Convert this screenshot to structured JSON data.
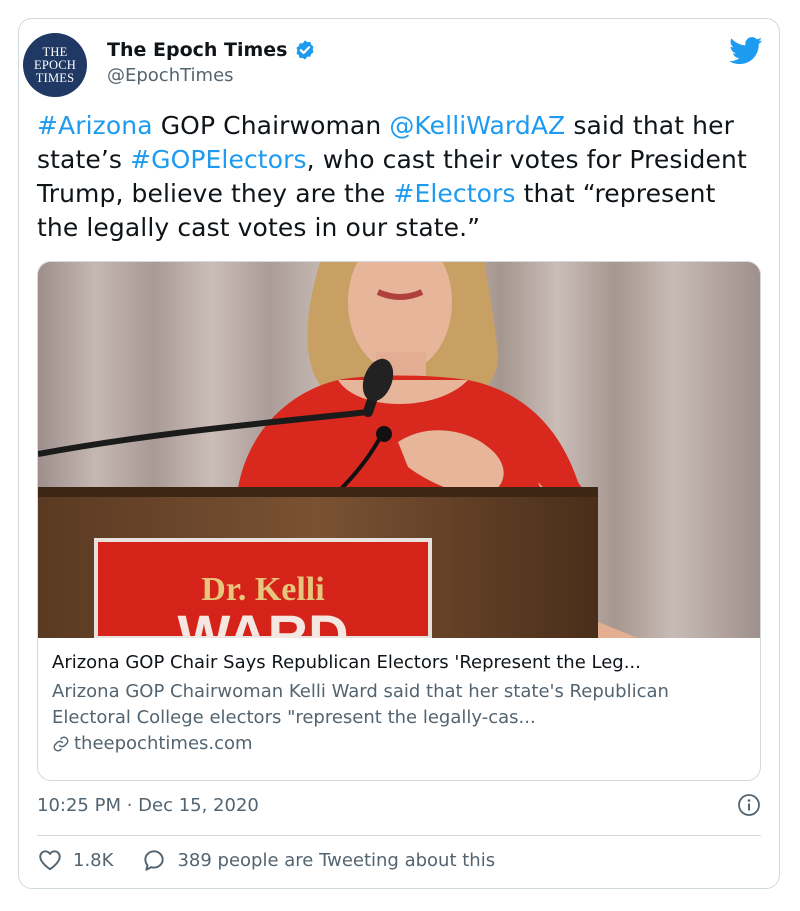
{
  "account": {
    "name": "The Epoch Times",
    "handle": "@EpochTimes",
    "avatar_lines": [
      "THE",
      "EPOCH",
      "TIMES"
    ]
  },
  "tweet": {
    "segments": [
      {
        "text": "#Arizona",
        "link": true
      },
      {
        "text": " GOP Chairwoman ",
        "link": false
      },
      {
        "text": "@KelliWardAZ",
        "link": true
      },
      {
        "text": " said that her state’s ",
        "link": false
      },
      {
        "text": "#GOPElectors",
        "link": true
      },
      {
        "text": ", who cast their votes for President Trump, believe they are the ",
        "link": false
      },
      {
        "text": "#Electors",
        "link": true
      },
      {
        "text": " that “represent the legally cast votes in our state.”",
        "link": false
      }
    ]
  },
  "card": {
    "sign_line1": "Dr. Kelli",
    "sign_line2": "WARD",
    "title": "Arizona GOP Chair Says Republican Electors 'Represent the Leg...",
    "description": "Arizona GOP Chairwoman Kelli Ward said that her state's Republican Electoral College electors \"represent the legally-cas...",
    "domain": "theepochtimes.com"
  },
  "timestamp": "10:25 PM · Dec 15, 2020",
  "actions": {
    "likes": "1.8K",
    "replies_label": "389 people are Tweeting about this"
  },
  "colors": {
    "link": "#1d9bf0",
    "muted": "#536471",
    "border": "#cfd9de",
    "verified": "#1d9bf0",
    "avatar_bg": "#1f3864",
    "dress": "#d9281e",
    "sign": "#d6231a"
  },
  "icons": {
    "verified": "verified-badge-icon",
    "brand": "twitter-bird-icon",
    "info": "info-icon",
    "like": "heart-icon",
    "reply": "speech-bubble-icon",
    "link": "link-icon"
  }
}
